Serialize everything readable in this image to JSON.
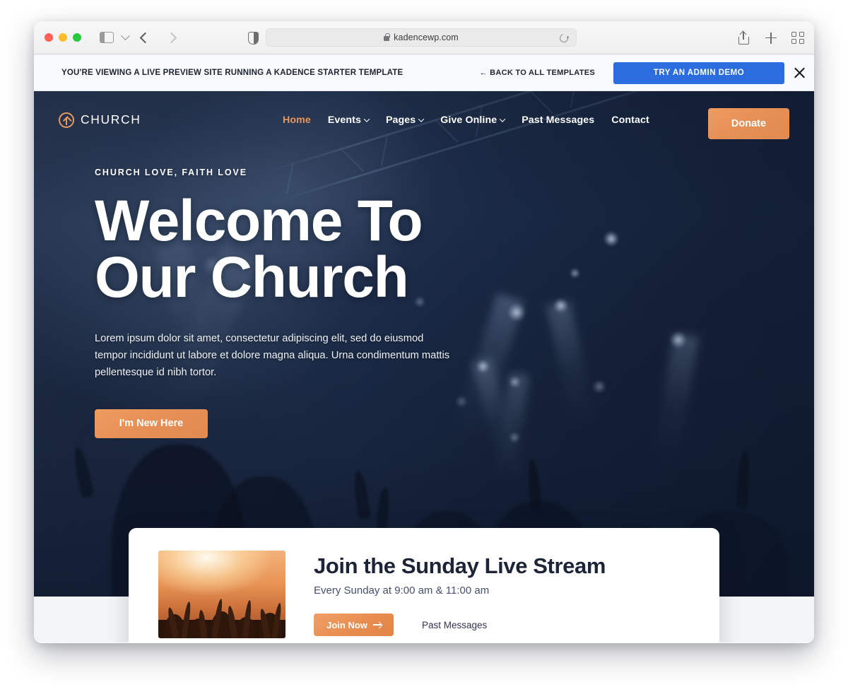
{
  "browser": {
    "url": "kadencewp.com",
    "lock_icon": "lock-icon",
    "reload_icon": "reload-icon",
    "sidebar_icon": "sidebar-toggle-icon",
    "tab_overview_icon": "tab-overview-icon",
    "share_icon": "share-icon",
    "new_tab_icon": "plus-icon",
    "back_icon": "back-arrow-icon",
    "forward_icon": "forward-arrow-icon",
    "shield_icon": "privacy-shield-icon"
  },
  "banner": {
    "message": "YOU'RE VIEWING A LIVE PREVIEW SITE RUNNING A KADENCE STARTER TEMPLATE",
    "back_link": "← BACK TO ALL TEMPLATES",
    "cta": "TRY AN ADMIN DEMO",
    "cta_color": "#2b6cdf",
    "close_icon": "close-icon"
  },
  "site_header": {
    "brand": "CHURCH",
    "brand_icon": "circle-up-arrow-logo",
    "accent_color": "#e8965c",
    "nav": [
      {
        "label": "Home",
        "has_caret": false,
        "active": true
      },
      {
        "label": "Events",
        "has_caret": true,
        "active": false
      },
      {
        "label": "Pages",
        "has_caret": true,
        "active": false
      },
      {
        "label": "Give Online",
        "has_caret": true,
        "active": false
      },
      {
        "label": "Past Messages",
        "has_caret": false,
        "active": false
      },
      {
        "label": "Contact",
        "has_caret": false,
        "active": false
      }
    ],
    "donate_label": "Donate"
  },
  "hero": {
    "eyebrow": "CHURCH LOVE, FAITH LOVE",
    "title_line1": "Welcome To",
    "title_line2": "Our Church",
    "paragraph": "Lorem ipsum dolor sit amet, consectetur adipiscing elit, sed do eiusmod tempor incididunt ut labore et dolore magna aliqua. Urna condimentum mattis pellentesque id nibh tortor.",
    "cta_label": "I'm New Here",
    "background_color": "#1c2c49"
  },
  "stream_card": {
    "thumbnail_alt": "concert-crowd-photo",
    "title": "Join the Sunday Live Stream",
    "subtitle": "Every Sunday at 9:00 am & 11:00 am",
    "join_label": "Join Now",
    "join_arrow_icon": "arrow-right-icon",
    "past_messages_label": "Past Messages"
  }
}
